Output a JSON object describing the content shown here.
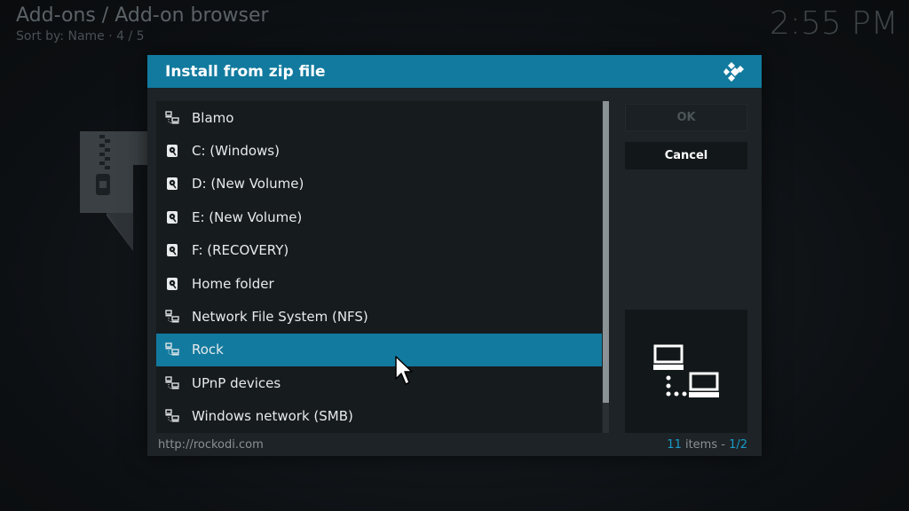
{
  "background": {
    "title": "Add-ons / Add-on browser",
    "subtitle": "Sort by: Name  ·  4 / 5",
    "clock": "2:55 PM"
  },
  "dialog": {
    "title": "Install from zip file",
    "logo_icon": "kodi-logo-icon",
    "items": [
      {
        "label": "Blamo",
        "icon": "network-icon"
      },
      {
        "label": "C: (Windows)",
        "icon": "drive-icon"
      },
      {
        "label": "D: (New Volume)",
        "icon": "drive-icon"
      },
      {
        "label": "E: (New Volume)",
        "icon": "drive-icon"
      },
      {
        "label": "F: (RECOVERY)",
        "icon": "drive-icon"
      },
      {
        "label": "Home folder",
        "icon": "drive-icon"
      },
      {
        "label": "Network File System (NFS)",
        "icon": "network-icon"
      },
      {
        "label": "Rock",
        "icon": "network-icon"
      },
      {
        "label": "UPnP devices",
        "icon": "network-icon"
      },
      {
        "label": "Windows network (SMB)",
        "icon": "network-icon"
      }
    ],
    "selected_index": 7,
    "buttons": {
      "ok_label": "OK",
      "cancel_label": "Cancel"
    },
    "preview_icon": "network-computers-icon",
    "footer": {
      "path": "http://rockodi.com",
      "item_count": "11",
      "items_word": " items - ",
      "page": "1/2"
    }
  },
  "colors": {
    "accent": "#127a9e",
    "accent_text": "#1a9cc7",
    "dialog_bg": "#1d2327"
  }
}
